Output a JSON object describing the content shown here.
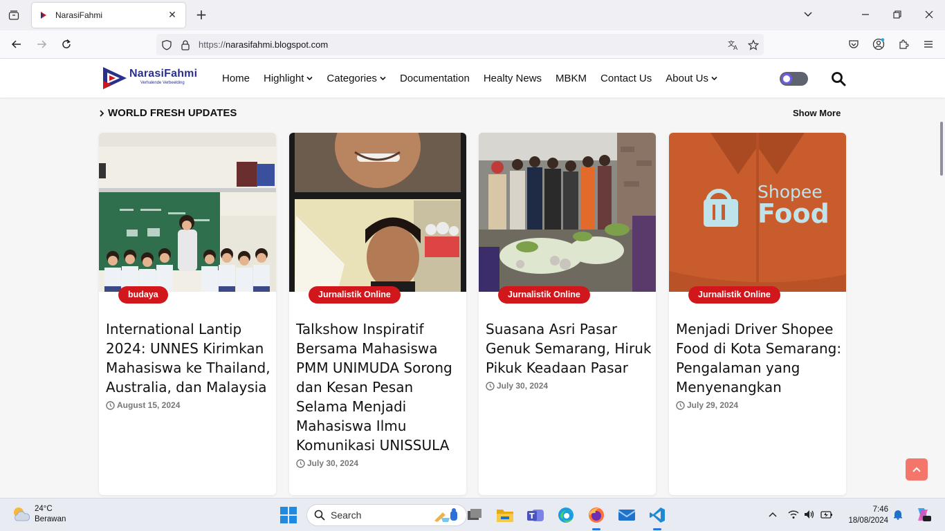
{
  "browser": {
    "tab_title": "NarasiFahmi",
    "url_prefix": "https://",
    "url_host": "narasifahmi.blogspot.com"
  },
  "site": {
    "logo_name": "NarasiFahmi",
    "logo_tagline": "Verhalende Verbeelding",
    "menu": [
      {
        "label": "Home",
        "dropdown": false
      },
      {
        "label": "Highlight",
        "dropdown": true
      },
      {
        "label": "Categories",
        "dropdown": true
      },
      {
        "label": "Documentation",
        "dropdown": false
      },
      {
        "label": "Healty News",
        "dropdown": false
      },
      {
        "label": "MBKM",
        "dropdown": false
      },
      {
        "label": "Contact Us",
        "dropdown": false
      },
      {
        "label": "About Us",
        "dropdown": true
      }
    ],
    "accent_color": "#d1171b"
  },
  "section": {
    "title": "WORLD FRESH UPDATES",
    "show_more": "Show More"
  },
  "cards": [
    {
      "category": "budaya",
      "title": "International Lantip 2024: UNNES Kirimkan Mahasiswa ke Thailand, Australia, dan Malaysia",
      "date": "August 15, 2024"
    },
    {
      "category": "Jurnalistik Online",
      "title": "Talkshow Inspiratif Bersama Mahasiswa PMM UNIMUDA Sorong dan Kesan Pesan Selama Menjadi Mahasiswa Ilmu Komunikasi UNISSULA",
      "date": "July 30, 2024"
    },
    {
      "category": "Jurnalistik Online",
      "title": "Suasana Asri Pasar Genuk Semarang, Hiruk Pikuk Keadaan Pasar",
      "date": "July 30, 2024"
    },
    {
      "category": "Jurnalistik Online",
      "title": "Menjadi Driver Shopee Food di Kota Semarang: Pengalaman yang Menyenangkan",
      "date": "July 29, 2024",
      "image_text": {
        "brand_top": "Shopee",
        "brand_bottom": "Food"
      }
    }
  ],
  "taskbar": {
    "temperature": "24°C",
    "weather": "Berawan",
    "search_placeholder": "Search",
    "time": "7:46",
    "date": "18/08/2024"
  }
}
